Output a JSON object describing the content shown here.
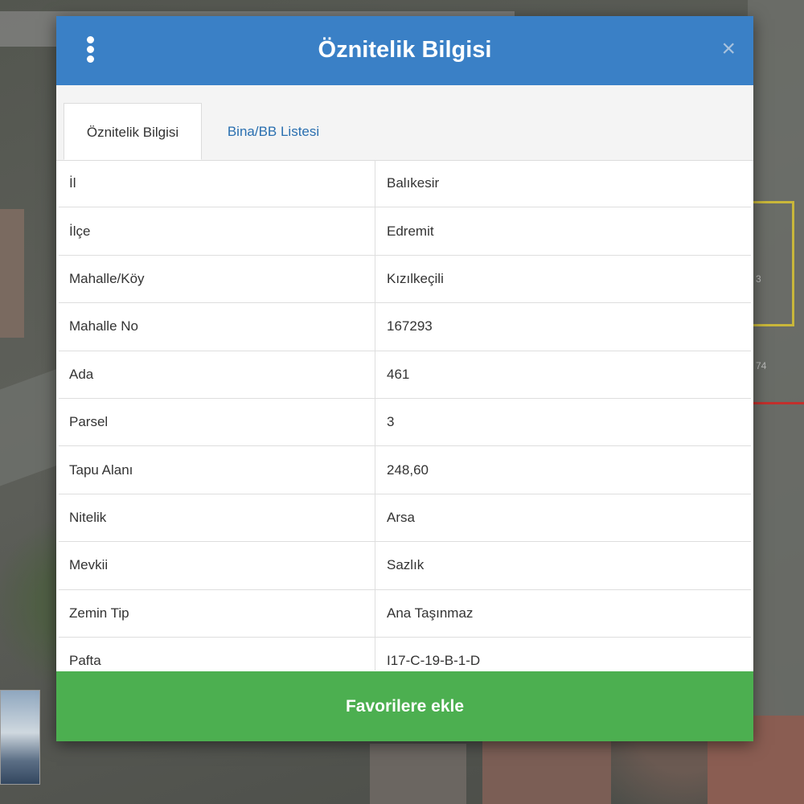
{
  "dialog": {
    "title": "Öznitelik Bilgisi",
    "menu_icon": "vertical-dots-icon",
    "close_label": "×"
  },
  "tabs": [
    {
      "label": "Öznitelik Bilgisi",
      "active": true
    },
    {
      "label": "Bina/BB Listesi",
      "active": false
    }
  ],
  "attributes": [
    {
      "key": "İl",
      "value": "Balıkesir"
    },
    {
      "key": "İlçe",
      "value": "Edremit"
    },
    {
      "key": "Mahalle/Köy",
      "value": "Kızılkeçili"
    },
    {
      "key": "Mahalle No",
      "value": "167293"
    },
    {
      "key": "Ada",
      "value": "461"
    },
    {
      "key": "Parsel",
      "value": "3"
    },
    {
      "key": "Tapu Alanı",
      "value": "248,60"
    },
    {
      "key": "Nitelik",
      "value": "Arsa"
    },
    {
      "key": "Mevkii",
      "value": "Sazlık"
    },
    {
      "key": "Zemin Tip",
      "value": "Ana Taşınmaz"
    },
    {
      "key": "Pafta",
      "value": "I17-C-19-B-1-D"
    }
  ],
  "favorite_button": "Favorilere ekle",
  "map_labels": {
    "parcel_a": "3",
    "parcel_b": "74"
  },
  "colors": {
    "header": "#3a80c6",
    "favorite": "#4caf50",
    "tab_link": "#2a6fb0"
  }
}
